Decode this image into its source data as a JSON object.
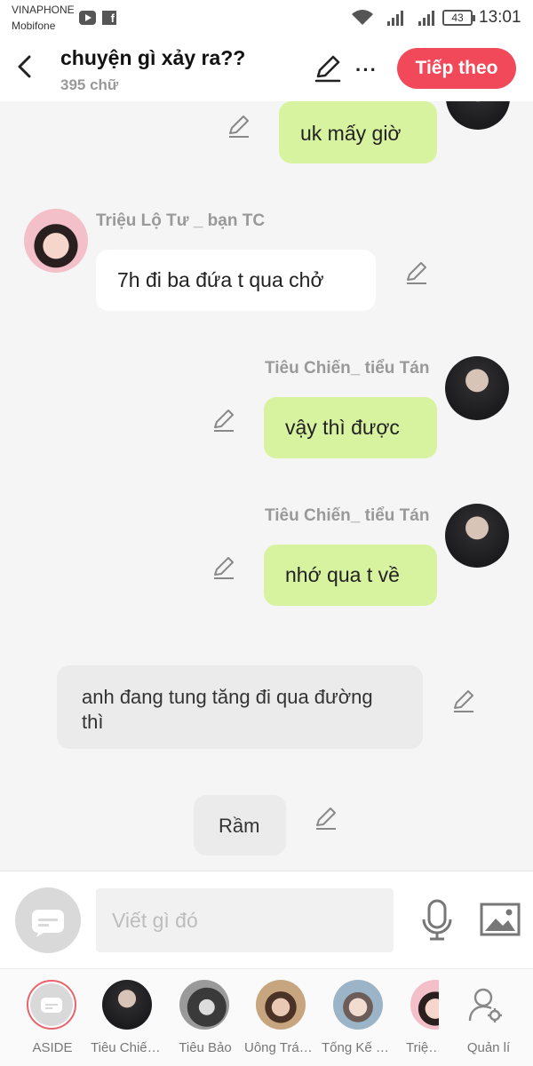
{
  "status_bar": {
    "carrier_primary": "VINAPHONE",
    "carrier_secondary": "Mobifone",
    "battery": "43",
    "time": "13:01"
  },
  "header": {
    "title": "chuyện gì xảy ra??",
    "word_count": "395 chữ",
    "more_label": "···",
    "next_button": "Tiếp theo"
  },
  "messages": [
    {
      "side": "right",
      "style": "green",
      "text": "uk mấy giờ"
    },
    {
      "side": "left",
      "style": "white",
      "sender": "Triệu Lộ Tư _ bạn TC",
      "text": "7h đi ba đứa t qua chở"
    },
    {
      "side": "right",
      "style": "green",
      "sender": "Tiêu Chiến_ tiểu Tán",
      "text": "vậy thì được"
    },
    {
      "side": "right",
      "style": "green",
      "sender": "Tiêu Chiến_ tiểu Tán",
      "text": "nhớ qua t về"
    },
    {
      "side": "aside",
      "style": "grey",
      "text": "anh đang tung tăng đi qua đường\nthì"
    },
    {
      "side": "aside",
      "style": "grey",
      "text": "Rầm"
    }
  ],
  "composer": {
    "placeholder": "Viết gì đó"
  },
  "characters": [
    {
      "name": "ASIDE",
      "icon": "aside-icon"
    },
    {
      "name": "Tiêu Chiến_ tiểu Tán"
    },
    {
      "name": "Tiêu Bảo"
    },
    {
      "name": "Uông Trác Thành"
    },
    {
      "name": "Tống Kế Dương"
    },
    {
      "name": "Triệu Lộ Tư _ bạn TC"
    },
    {
      "name": "Quản lí",
      "icon": "manage-user-icon"
    }
  ],
  "colors": {
    "accent": "#f2495a",
    "bubble_green": "#d8f3a0",
    "bubble_white": "#ffffff",
    "bubble_grey": "#ebebeb"
  }
}
